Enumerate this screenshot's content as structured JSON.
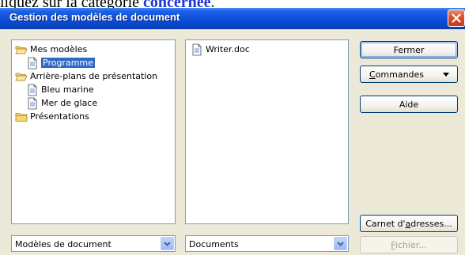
{
  "background_text": {
    "prefix": "liquez sur la catégorie ",
    "highlight": "concernée",
    "suffix": "."
  },
  "window": {
    "title": "Gestion des modèles de document"
  },
  "categories": {
    "items": [
      {
        "label": "Mes modèles",
        "icon": "folder-open-icon",
        "level": 0,
        "selected": false
      },
      {
        "label": "Programme",
        "icon": "document-icon",
        "level": 1,
        "selected": true
      },
      {
        "label": "Arrière-plans de présentation",
        "icon": "folder-open-icon",
        "level": 0,
        "selected": false
      },
      {
        "label": "Bleu marine",
        "icon": "document-icon",
        "level": 1,
        "selected": false
      },
      {
        "label": "Mer de glace",
        "icon": "document-icon",
        "level": 1,
        "selected": false
      },
      {
        "label": "Présentations",
        "icon": "folder-closed-icon",
        "level": 0,
        "selected": false
      }
    ]
  },
  "documents": {
    "items": [
      {
        "label": "Writer.doc",
        "icon": "document-icon"
      }
    ]
  },
  "buttons": {
    "fermer": "Fermer",
    "commandes_pre": "",
    "commandes_key": "C",
    "commandes_post": "ommandes",
    "aide": "Aide",
    "carnet_pre": "Carnet d'",
    "carnet_key": "a",
    "carnet_post": "dresses...",
    "fichier_pre": "",
    "fichier_key": "F",
    "fichier_post": "ichier..."
  },
  "selects": {
    "left_value": "Modèles de document",
    "right_value": "Documents"
  },
  "colors": {
    "title_bar": "#0a4fd8",
    "dialog_bg": "#ece9d8",
    "selection": "#316ac5",
    "close_button": "#d8512e",
    "highlight_text": "#1f34d6"
  }
}
